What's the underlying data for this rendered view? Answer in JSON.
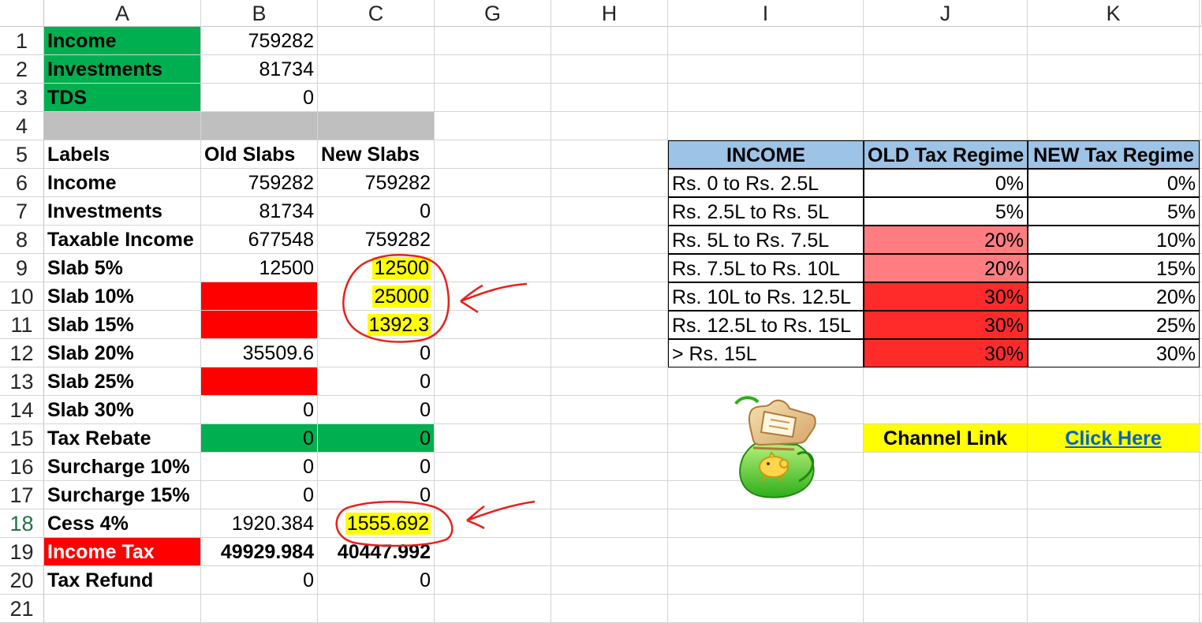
{
  "columns": [
    "A",
    "B",
    "C",
    "G",
    "H",
    "I",
    "J",
    "K"
  ],
  "rows": [
    "1",
    "2",
    "3",
    "4",
    "5",
    "6",
    "7",
    "8",
    "9",
    "10",
    "11",
    "12",
    "13",
    "14",
    "15",
    "16",
    "17",
    "18",
    "19",
    "20",
    "21"
  ],
  "cells": {
    "A1": "Income",
    "B1": "759282",
    "A2": "Investments",
    "B2": "81734",
    "A3": "TDS",
    "B3": "0",
    "A5": "Labels",
    "B5": "Old Slabs",
    "C5": "New Slabs",
    "A6": "Income",
    "B6": "759282",
    "C6": "759282",
    "A7": "Investments",
    "B7": "81734",
    "C7": "0",
    "A8": "Taxable Income",
    "B8": "677548",
    "C8": "759282",
    "A9": "Slab 5%",
    "B9": "12500",
    "C9": "12500",
    "A10": "Slab 10%",
    "C10": "25000",
    "A11": "Slab 15%",
    "C11": "1392.3",
    "A12": "Slab 20%",
    "B12": "35509.6",
    "C12": "0",
    "A13": "Slab 25%",
    "C13": "0",
    "A14": "Slab 30%",
    "B14": "0",
    "C14": "0",
    "A15": "Tax Rebate",
    "B15": "0",
    "C15": "0",
    "A16": "Surcharge 10%",
    "B16": "0",
    "C16": "0",
    "A17": "Surcharge 15%",
    "B17": "0",
    "C17": "0",
    "A18": "Cess 4%",
    "B18": "1920.384",
    "C18": "1555.692",
    "A19": "Income Tax",
    "B19": "49929.984",
    "C19": "40447.992",
    "A20": "Tax Refund",
    "B20": "0",
    "C20": "0",
    "I5": "INCOME",
    "J5": "OLD Tax Regime",
    "K5": "NEW Tax Regime",
    "I6": "Rs. 0 to Rs. 2.5L",
    "J6": "0%",
    "K6": "0%",
    "I7": "Rs. 2.5L to Rs. 5L",
    "J7": "5%",
    "K7": "5%",
    "I8": "Rs. 5L to Rs. 7.5L",
    "J8": "20%",
    "K8": "10%",
    "I9": "Rs. 7.5L to Rs. 10L",
    "J9": "20%",
    "K9": "15%",
    "I10": "Rs. 10L to Rs. 12.5L",
    "J10": "30%",
    "K10": "20%",
    "I11": "Rs. 12.5L to Rs. 15L",
    "J11": "30%",
    "K11": "25%",
    "I12": "> Rs. 15L",
    "J12": "30%",
    "K12": "30%",
    "J15": "Channel Link",
    "K15": "Click Here"
  },
  "selected_row": "18",
  "colors": {
    "label_green": "#00b050",
    "blank_red": "#ff0000",
    "highlight_yellow": "#ffff00",
    "table_header_blue": "#9dc3e6",
    "old_regime_light_red": "#ff7c80",
    "old_regime_red": "#ff2b2b",
    "annotation_red": "#e8211d",
    "link_blue": "#0563c1"
  },
  "icons": [
    "money-bag-icon",
    "piggy-bank-icon"
  ]
}
